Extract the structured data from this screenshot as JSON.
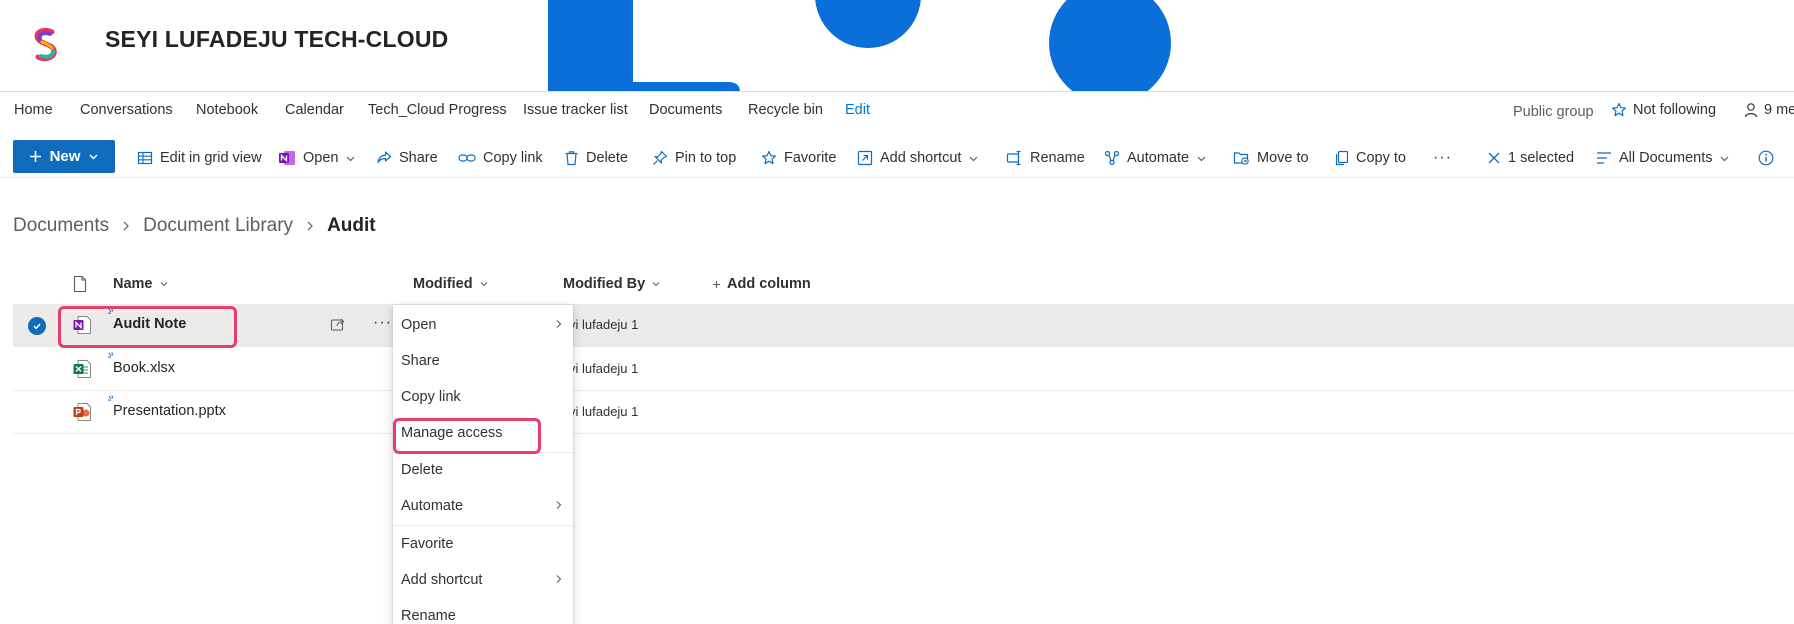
{
  "header": {
    "site_title": "SEYI LUFADEJU TECH-CLOUD",
    "accent_color": "#0078d4"
  },
  "nav": {
    "items": [
      "Home",
      "Conversations",
      "Notebook",
      "Calendar",
      "Tech_Cloud Progress",
      "Issue tracker list",
      "Documents",
      "Recycle bin"
    ],
    "edit_label": "Edit",
    "public_group": "Public group",
    "follow_label": "Not following",
    "members_label": "9 me"
  },
  "commandbar": {
    "new_label": "New",
    "edit_grid": "Edit in grid view",
    "open": "Open",
    "share": "Share",
    "copy_link": "Copy link",
    "delete": "Delete",
    "pin_to_top": "Pin to top",
    "favorite": "Favorite",
    "add_shortcut": "Add shortcut",
    "rename": "Rename",
    "automate": "Automate",
    "move_to": "Move to",
    "copy_to": "Copy to",
    "more": "···",
    "selected": "1 selected",
    "view": "All Documents"
  },
  "breadcrumb": {
    "items": [
      "Documents",
      "Document Library"
    ],
    "current": "Audit"
  },
  "list": {
    "columns": {
      "name": "Name",
      "modified": "Modified",
      "modified_by": "Modified By",
      "add_column": "Add column"
    },
    "rows": [
      {
        "name": "Audit Note",
        "type": "onenote",
        "modified_by": "yi lufadeju 1",
        "selected": true
      },
      {
        "name": "Book.xlsx",
        "type": "excel",
        "modified_by": "yi lufadeju 1",
        "selected": false
      },
      {
        "name": "Presentation.pptx",
        "type": "powerpoint",
        "modified_by": "yi lufadeju 1",
        "selected": false
      }
    ]
  },
  "context_menu": {
    "items": [
      "Open",
      "Share",
      "Copy link",
      "Manage access",
      "Delete",
      "Automate",
      "Favorite",
      "Add shortcut",
      "Rename"
    ]
  }
}
